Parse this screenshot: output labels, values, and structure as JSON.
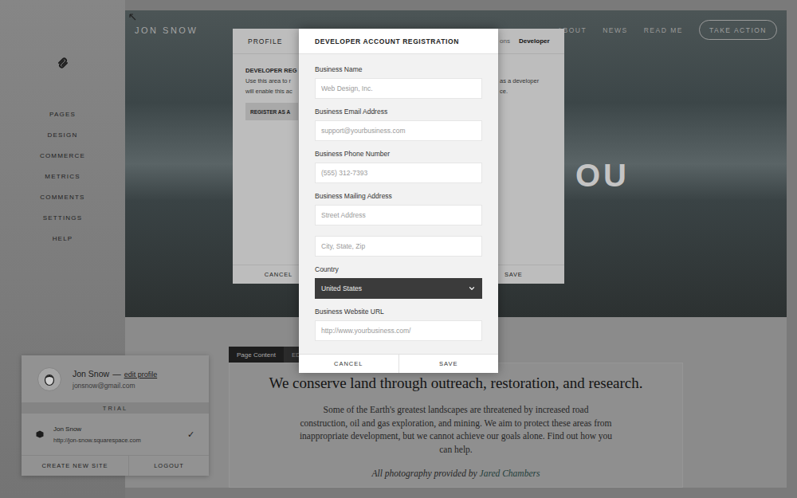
{
  "sidebar": {
    "items": [
      "PAGES",
      "DESIGN",
      "COMMERCE",
      "METRICS",
      "COMMENTS",
      "SETTINGS",
      "HELP"
    ]
  },
  "site": {
    "title": "JON SNOW",
    "nav": [
      "ABOUT",
      "NEWS",
      "READ ME"
    ],
    "cta": "TAKE ACTION",
    "hero_heading": "OU",
    "editor_tabs": [
      {
        "label": "Page Content",
        "selected": true
      },
      {
        "label": "ED",
        "selected": false
      }
    ],
    "heading": "We conserve land through outreach, restoration, and research.",
    "body": "Some of the Earth's greatest landscapes are threatened by increased road construction, oil and gas exploration, and mining. We aim to protect these areas from inappropriate development, but we cannot achieve our goals alone. Find out how you can help.",
    "credit": {
      "text": "All photography provided by ",
      "link": "Jared Chambers"
    }
  },
  "account_panel": {
    "name": "Jon Snow",
    "separator": "—",
    "edit_link": "edit profile",
    "email": "jonsnow@gmail.com",
    "plan": "TRIAL",
    "sites": [
      {
        "name": "Jon Snow",
        "url": "http://jon-snow.squarespace.com",
        "selected": true,
        "mark": "✓"
      }
    ],
    "actions": [
      "CREATE NEW SITE",
      "LOGOUT"
    ]
  },
  "profile_dialog": {
    "title": "PROFILE",
    "tabs": [
      {
        "label": "ons",
        "selected": false
      },
      {
        "label": "Developer",
        "selected": true
      }
    ],
    "heading": "DEVELOPER REG",
    "left_lines": [
      "Use this area to r",
      "will enable this ac"
    ],
    "button": "REGISTER AS A",
    "right_lines": [
      "as a developer",
      "ce."
    ],
    "buttons": [
      "CANCEL",
      "SAVE"
    ]
  },
  "registration_dialog": {
    "title": "DEVELOPER ACCOUNT REGISTRATION",
    "fields": [
      {
        "label": "Business Name",
        "kind": "text",
        "placeholders": [
          "Web Design, Inc."
        ]
      },
      {
        "label": "Business Email Address",
        "kind": "text",
        "placeholders": [
          "support@yourbusiness.com"
        ]
      },
      {
        "label": "Business Phone Number",
        "kind": "text",
        "placeholders": [
          "(555) 312-7393"
        ]
      },
      {
        "label": "Business Mailing Address",
        "kind": "text",
        "placeholders": [
          "Street Address",
          "City, State, Zip"
        ]
      },
      {
        "label": "Country",
        "kind": "select",
        "value": "United States"
      },
      {
        "label": "Business Website URL",
        "kind": "text",
        "placeholders": [
          "http://www.yourbusiness.com/"
        ]
      }
    ],
    "buttons": [
      "CANCEL",
      "SAVE"
    ]
  }
}
